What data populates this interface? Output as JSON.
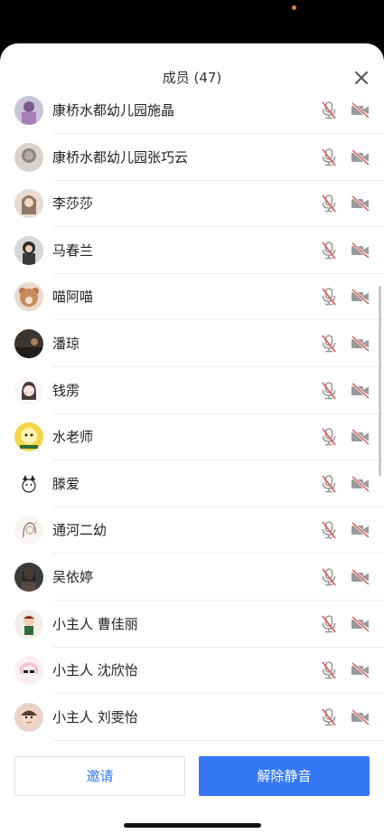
{
  "header": {
    "title": "成员 (47)",
    "close_icon": "close-icon"
  },
  "members": [
    {
      "name": "康桥水都幼儿园施晶",
      "avatar": "photo-purple"
    },
    {
      "name": "康桥水都幼儿园张巧云",
      "avatar": "photo-grey"
    },
    {
      "name": "李莎莎",
      "avatar": "photo-girl"
    },
    {
      "name": "马春兰",
      "avatar": "photo-dark"
    },
    {
      "name": "喵阿喵",
      "avatar": "photo-bear"
    },
    {
      "name": "潘琼",
      "avatar": "photo-sunset"
    },
    {
      "name": "钱雳",
      "avatar": "drawing-girl"
    },
    {
      "name": "水老师",
      "avatar": "cartoon-yellow"
    },
    {
      "name": "滕爱",
      "avatar": "drawing-face"
    },
    {
      "name": "通河二幼",
      "avatar": "drawing-sketch"
    },
    {
      "name": "吴依婷",
      "avatar": "photo-person"
    },
    {
      "name": "小主人 曹佳丽",
      "avatar": "cartoon-kid"
    },
    {
      "name": "小主人 沈欣怡",
      "avatar": "cartoon-sunglasses"
    },
    {
      "name": "小主人 刘雯怡",
      "avatar": "photo-child"
    }
  ],
  "row_icons": {
    "mic": "mic-muted-icon",
    "camera": "camera-off-icon"
  },
  "colors": {
    "accent": "#3478f6",
    "muted_slash": "#e0574f",
    "icon_grey": "#9a9a9a"
  },
  "footer": {
    "invite_label": "邀请",
    "unmute_label": "解除静音"
  }
}
